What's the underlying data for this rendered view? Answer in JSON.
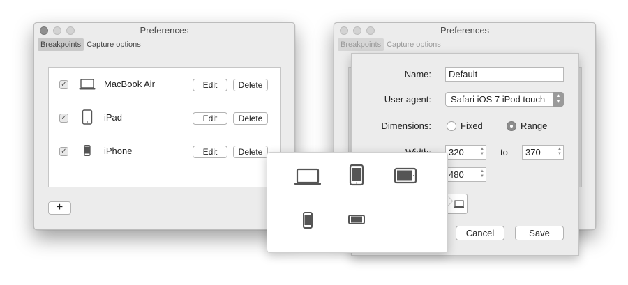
{
  "window1": {
    "title": "Preferences",
    "tabs": [
      "Breakpoints",
      "Capture options"
    ],
    "devices": [
      {
        "name": "MacBook Air",
        "checked": true,
        "icon": "laptop-icon"
      },
      {
        "name": "iPad",
        "checked": true,
        "icon": "tablet-icon"
      },
      {
        "name": "iPhone",
        "checked": true,
        "icon": "phone-icon"
      }
    ],
    "edit_label": "Edit",
    "delete_label": "Delete",
    "add_label": "+"
  },
  "window2": {
    "title": "Preferences",
    "tabs": [
      "Breakpoints",
      "Capture options"
    ]
  },
  "sheet": {
    "name_label": "Name:",
    "name_value": "Default",
    "user_agent_label": "User agent:",
    "user_agent_value": "Safari iOS 7 iPod touch",
    "dimensions_label": "Dimensions:",
    "fixed_label": "Fixed",
    "range_label": "Range",
    "selected_dimension": "Range",
    "width_label": "Width:",
    "width_from": "320",
    "to_label": "to",
    "width_to": "370",
    "height_value": "480",
    "cancel_label": "Cancel",
    "save_label": "Save"
  },
  "popover": {
    "icons": [
      "laptop-icon",
      "tablet-portrait-icon",
      "tablet-landscape-icon",
      "phone-portrait-icon",
      "phone-landscape-icon"
    ]
  },
  "colors": {
    "window_bg": "#ececec",
    "selection_gray": "#8d8d8d",
    "icon_gray": "#555555"
  }
}
